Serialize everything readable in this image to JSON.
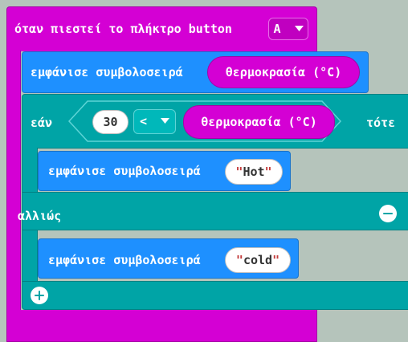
{
  "event_block": {
    "label": "όταν πιεστεί το πλήκτρο button",
    "button_value": "A",
    "dropdown_icon": "triangle-down-icon"
  },
  "show_temp": {
    "label": "εμφάνισε συμβολοσειρά",
    "arg": "θερμοκρασία (°C)"
  },
  "if_block": {
    "if_label": "εάν",
    "then_label": "τότε",
    "else_label": "αλλιώς",
    "left_value": "30",
    "operator": "<",
    "right_arg": "θερμοκρασία (°C)",
    "remove_else_icon": "minus-circle-icon",
    "add_else_icon": "plus-circle-icon"
  },
  "show_hot": {
    "label": "εμφάνισε συμβολοσειρά",
    "open_quote": "\"",
    "value": "Hot",
    "close_quote": "\""
  },
  "show_cold": {
    "label": "εμφάνισε συμβολοσειρά",
    "open_quote": "\"",
    "value": "cold",
    "close_quote": "\""
  },
  "colors": {
    "event": "#d400d4",
    "basic": "#1e90ff",
    "logic": "#00a4a6",
    "workspace": "#b5c4bb"
  }
}
